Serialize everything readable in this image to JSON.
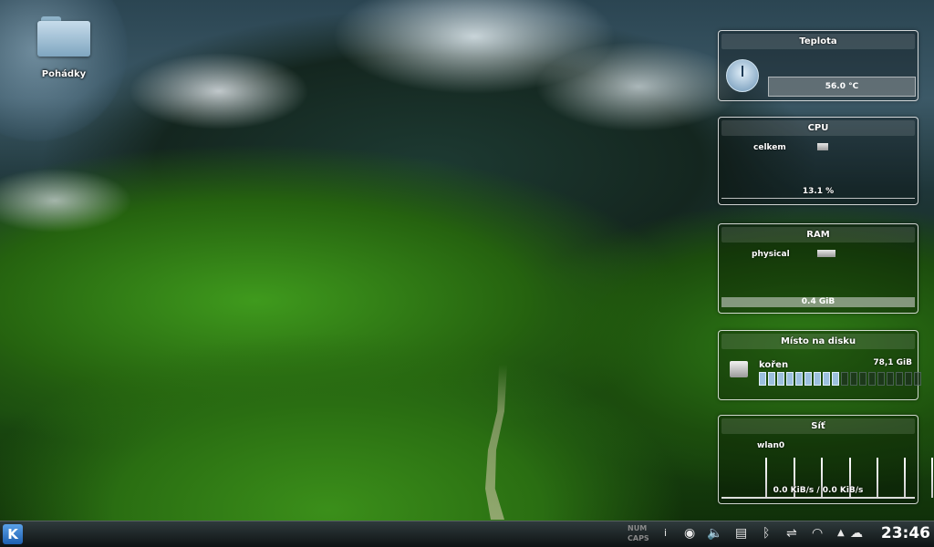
{
  "desktop": {
    "icons": [
      {
        "label": "Pohádky",
        "icon": "folder-icon"
      }
    ]
  },
  "widgets": {
    "temperature": {
      "title": "Teplota",
      "value": "56.0 °C",
      "icon": "thermometer-gauge-icon"
    },
    "cpu": {
      "title": "CPU",
      "label": "celkem",
      "value": "13.1 %"
    },
    "ram": {
      "title": "RAM",
      "label": "physical",
      "value": "0.4 GiB"
    },
    "disk": {
      "title": "Místo na disku",
      "label": "kořen",
      "value": "78,1 GiB",
      "used_segments": 9,
      "total_segments": 18,
      "icon": "hard-drive-icon"
    },
    "network": {
      "title": "Síť",
      "label": "wlan0",
      "value": "0.0 KiB/s / 0.0 KiB/s"
    }
  },
  "panel": {
    "launcher_icon": "kde-logo-icon",
    "lock_labels": [
      "NUM",
      "CAPS"
    ],
    "tray_icons": [
      "info-icon",
      "cd-icon",
      "volume-icon",
      "clipboard-icon",
      "bluetooth-icon",
      "usb-icon",
      "wifi-icon",
      "expand-arrow-icon",
      "weather-cloud-icon"
    ],
    "clock": "23:46"
  }
}
